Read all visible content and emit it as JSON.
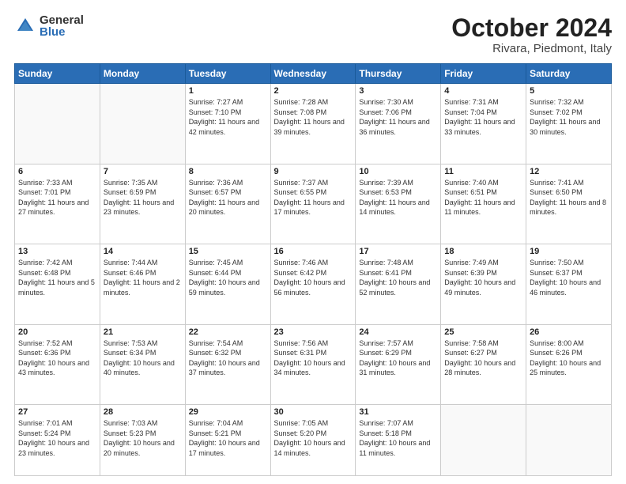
{
  "header": {
    "logo_general": "General",
    "logo_blue": "Blue",
    "month_title": "October 2024",
    "location": "Rivara, Piedmont, Italy"
  },
  "weekdays": [
    "Sunday",
    "Monday",
    "Tuesday",
    "Wednesday",
    "Thursday",
    "Friday",
    "Saturday"
  ],
  "weeks": [
    [
      {
        "day": "",
        "info": ""
      },
      {
        "day": "",
        "info": ""
      },
      {
        "day": "1",
        "info": "Sunrise: 7:27 AM\nSunset: 7:10 PM\nDaylight: 11 hours and 42 minutes."
      },
      {
        "day": "2",
        "info": "Sunrise: 7:28 AM\nSunset: 7:08 PM\nDaylight: 11 hours and 39 minutes."
      },
      {
        "day": "3",
        "info": "Sunrise: 7:30 AM\nSunset: 7:06 PM\nDaylight: 11 hours and 36 minutes."
      },
      {
        "day": "4",
        "info": "Sunrise: 7:31 AM\nSunset: 7:04 PM\nDaylight: 11 hours and 33 minutes."
      },
      {
        "day": "5",
        "info": "Sunrise: 7:32 AM\nSunset: 7:02 PM\nDaylight: 11 hours and 30 minutes."
      }
    ],
    [
      {
        "day": "6",
        "info": "Sunrise: 7:33 AM\nSunset: 7:01 PM\nDaylight: 11 hours and 27 minutes."
      },
      {
        "day": "7",
        "info": "Sunrise: 7:35 AM\nSunset: 6:59 PM\nDaylight: 11 hours and 23 minutes."
      },
      {
        "day": "8",
        "info": "Sunrise: 7:36 AM\nSunset: 6:57 PM\nDaylight: 11 hours and 20 minutes."
      },
      {
        "day": "9",
        "info": "Sunrise: 7:37 AM\nSunset: 6:55 PM\nDaylight: 11 hours and 17 minutes."
      },
      {
        "day": "10",
        "info": "Sunrise: 7:39 AM\nSunset: 6:53 PM\nDaylight: 11 hours and 14 minutes."
      },
      {
        "day": "11",
        "info": "Sunrise: 7:40 AM\nSunset: 6:51 PM\nDaylight: 11 hours and 11 minutes."
      },
      {
        "day": "12",
        "info": "Sunrise: 7:41 AM\nSunset: 6:50 PM\nDaylight: 11 hours and 8 minutes."
      }
    ],
    [
      {
        "day": "13",
        "info": "Sunrise: 7:42 AM\nSunset: 6:48 PM\nDaylight: 11 hours and 5 minutes."
      },
      {
        "day": "14",
        "info": "Sunrise: 7:44 AM\nSunset: 6:46 PM\nDaylight: 11 hours and 2 minutes."
      },
      {
        "day": "15",
        "info": "Sunrise: 7:45 AM\nSunset: 6:44 PM\nDaylight: 10 hours and 59 minutes."
      },
      {
        "day": "16",
        "info": "Sunrise: 7:46 AM\nSunset: 6:42 PM\nDaylight: 10 hours and 56 minutes."
      },
      {
        "day": "17",
        "info": "Sunrise: 7:48 AM\nSunset: 6:41 PM\nDaylight: 10 hours and 52 minutes."
      },
      {
        "day": "18",
        "info": "Sunrise: 7:49 AM\nSunset: 6:39 PM\nDaylight: 10 hours and 49 minutes."
      },
      {
        "day": "19",
        "info": "Sunrise: 7:50 AM\nSunset: 6:37 PM\nDaylight: 10 hours and 46 minutes."
      }
    ],
    [
      {
        "day": "20",
        "info": "Sunrise: 7:52 AM\nSunset: 6:36 PM\nDaylight: 10 hours and 43 minutes."
      },
      {
        "day": "21",
        "info": "Sunrise: 7:53 AM\nSunset: 6:34 PM\nDaylight: 10 hours and 40 minutes."
      },
      {
        "day": "22",
        "info": "Sunrise: 7:54 AM\nSunset: 6:32 PM\nDaylight: 10 hours and 37 minutes."
      },
      {
        "day": "23",
        "info": "Sunrise: 7:56 AM\nSunset: 6:31 PM\nDaylight: 10 hours and 34 minutes."
      },
      {
        "day": "24",
        "info": "Sunrise: 7:57 AM\nSunset: 6:29 PM\nDaylight: 10 hours and 31 minutes."
      },
      {
        "day": "25",
        "info": "Sunrise: 7:58 AM\nSunset: 6:27 PM\nDaylight: 10 hours and 28 minutes."
      },
      {
        "day": "26",
        "info": "Sunrise: 8:00 AM\nSunset: 6:26 PM\nDaylight: 10 hours and 25 minutes."
      }
    ],
    [
      {
        "day": "27",
        "info": "Sunrise: 7:01 AM\nSunset: 5:24 PM\nDaylight: 10 hours and 23 minutes."
      },
      {
        "day": "28",
        "info": "Sunrise: 7:03 AM\nSunset: 5:23 PM\nDaylight: 10 hours and 20 minutes."
      },
      {
        "day": "29",
        "info": "Sunrise: 7:04 AM\nSunset: 5:21 PM\nDaylight: 10 hours and 17 minutes."
      },
      {
        "day": "30",
        "info": "Sunrise: 7:05 AM\nSunset: 5:20 PM\nDaylight: 10 hours and 14 minutes."
      },
      {
        "day": "31",
        "info": "Sunrise: 7:07 AM\nSunset: 5:18 PM\nDaylight: 10 hours and 11 minutes."
      },
      {
        "day": "",
        "info": ""
      },
      {
        "day": "",
        "info": ""
      }
    ]
  ]
}
